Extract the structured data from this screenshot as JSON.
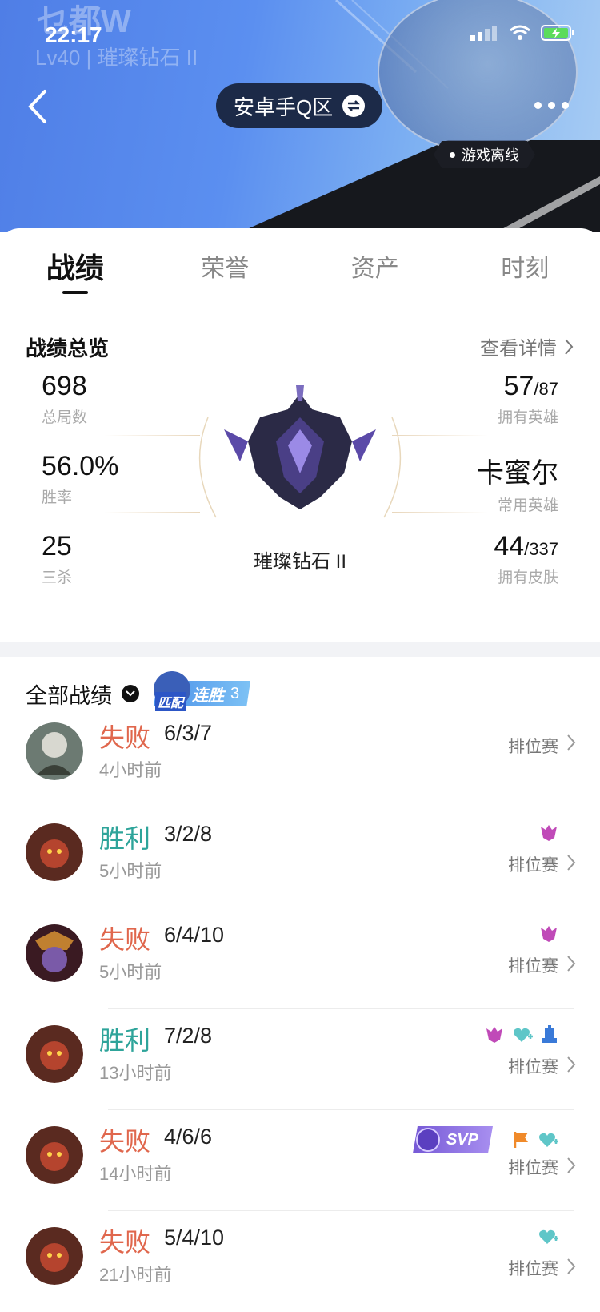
{
  "status_bar": {
    "time": "22:17"
  },
  "header": {
    "ghost_name": "乜都W",
    "ghost_level": "Lv40 | 璀璨钻石 II",
    "server": "安卓手Q区",
    "online_status": "游戏离线"
  },
  "tabs": [
    {
      "label": "战绩",
      "active": true
    },
    {
      "label": "荣誉",
      "active": false
    },
    {
      "label": "资产",
      "active": false
    },
    {
      "label": "时刻",
      "active": false
    }
  ],
  "overview": {
    "title": "战绩总览",
    "detail_link": "查看详情",
    "rank": "璀璨钻石 II",
    "stats_left": [
      {
        "value": "698",
        "label": "总局数"
      },
      {
        "value": "56.0%",
        "label": "胜率"
      },
      {
        "value": "25",
        "label": "三杀"
      }
    ],
    "stats_right": [
      {
        "value": "57",
        "suffix": "/87",
        "label": "拥有英雄"
      },
      {
        "value": "卡蜜尔",
        "suffix": "",
        "label": "常用英雄"
      },
      {
        "value": "44",
        "suffix": "/337",
        "label": "拥有皮肤"
      }
    ]
  },
  "match_list": {
    "filter_label": "全部战绩",
    "streak_mode": "匹配",
    "streak_label": "连胜",
    "streak_count": "3",
    "matches": [
      {
        "result": "失败",
        "kda": "6/3/7",
        "time": "4小时前",
        "mode": "排位赛",
        "hero": "silver-hair-hero"
      },
      {
        "result": "胜利",
        "kda": "3/2/8",
        "time": "5小时前",
        "mode": "排位赛",
        "hero": "monkey-king"
      },
      {
        "result": "失败",
        "kda": "6/4/10",
        "time": "5小时前",
        "mode": "排位赛",
        "hero": "purple-demon-hero"
      },
      {
        "result": "胜利",
        "kda": "7/2/8",
        "time": "13小时前",
        "mode": "排位赛",
        "hero": "monkey-king"
      },
      {
        "result": "失败",
        "kda": "4/6/6",
        "time": "14小时前",
        "mode": "排位赛",
        "hero": "monkey-king",
        "svp": "SVP"
      },
      {
        "result": "失败",
        "kda": "5/4/10",
        "time": "21小时前",
        "mode": "排位赛",
        "hero": "monkey-king"
      }
    ]
  },
  "colors": {
    "lose": "#e0674d",
    "win": "#2ea49a",
    "header_blue": "#5b8ff0"
  }
}
